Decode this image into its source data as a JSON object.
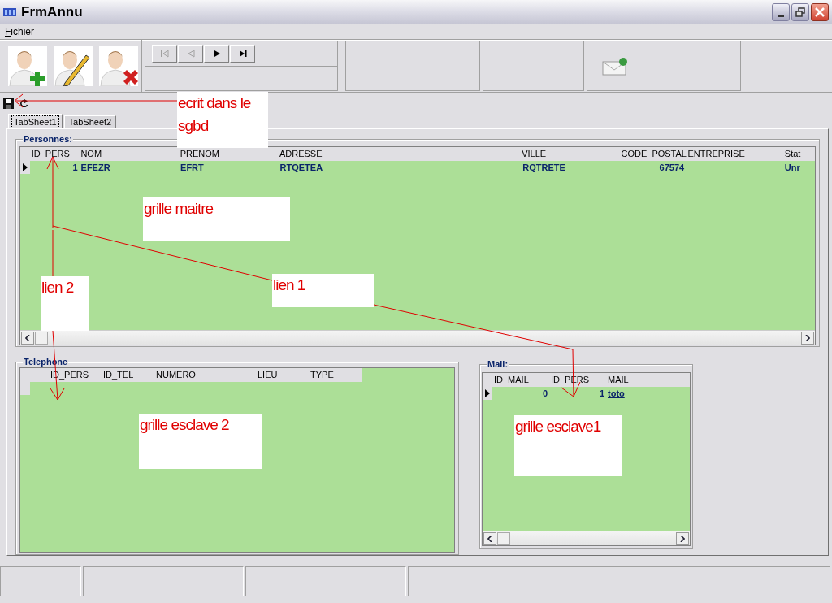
{
  "window": {
    "title": "FrmAnnu"
  },
  "menu": [
    "Fichier"
  ],
  "navigator": [
    {
      "kind": "first",
      "disabled": true
    },
    {
      "kind": "prior",
      "disabled": true
    },
    {
      "kind": "next",
      "disabled": false
    },
    {
      "kind": "last",
      "disabled": false
    }
  ],
  "tabs": [
    {
      "label": "TabSheet1",
      "selected": true
    },
    {
      "label": "TabSheet2",
      "selected": false
    }
  ],
  "personnes": {
    "title": "Personnes:",
    "columns": [
      "ID_PERS",
      "NOM",
      "PRENOM",
      "ADRESSE",
      "VILLE",
      "CODE_POSTAL",
      "ENTREPRISE",
      "Stat"
    ],
    "rows": [
      {
        "selected": true,
        "cells": [
          "1",
          "EFEZR",
          "EFRT",
          "RTQETEA",
          "RQTRETE",
          "67574",
          null,
          "Unr"
        ]
      }
    ]
  },
  "telephone": {
    "title": "Telephone",
    "columns": [
      "ID_PERS",
      "ID_TEL",
      "NUMERO",
      "LIEU",
      "TYPE"
    ]
  },
  "mail": {
    "title": "Mail:",
    "columns": [
      "ID_MAIL",
      "ID_PERS",
      "MAIL"
    ],
    "rows": [
      {
        "selected": true,
        "cells": [
          "0",
          "1",
          "toto"
        ]
      }
    ]
  },
  "annotations": [
    "ecrit dans le sgbd",
    "grille maitre",
    "lien 2",
    "lien 1",
    "grille esclave 2",
    "grille esclave1"
  ]
}
